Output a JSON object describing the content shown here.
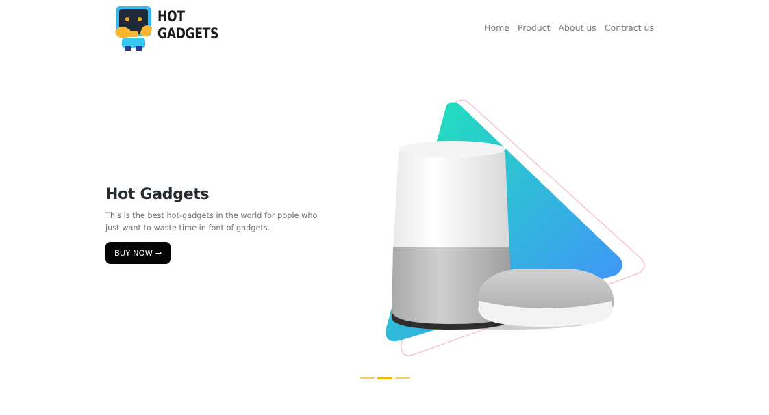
{
  "brand": {
    "line1": "HOT",
    "line2": "GADGETS"
  },
  "nav": {
    "items": [
      {
        "label": "Home"
      },
      {
        "label": "Product"
      },
      {
        "label": "About us"
      },
      {
        "label": "Contract us"
      }
    ]
  },
  "hero": {
    "title": "Hot Gadgets",
    "description": "This is the best hot-gadgets in the world for pople who just want to waste time in font of gadgets.",
    "button_label": "BUY NOW →"
  },
  "carousel": {
    "slides": 3,
    "active_index": 1
  },
  "colors": {
    "gradient_start": "#1de9b6",
    "gradient_end": "#448aff",
    "button_bg": "#050505",
    "indicator": "#f2b705"
  },
  "icons": {
    "logo": "robot-mascot-icon"
  }
}
